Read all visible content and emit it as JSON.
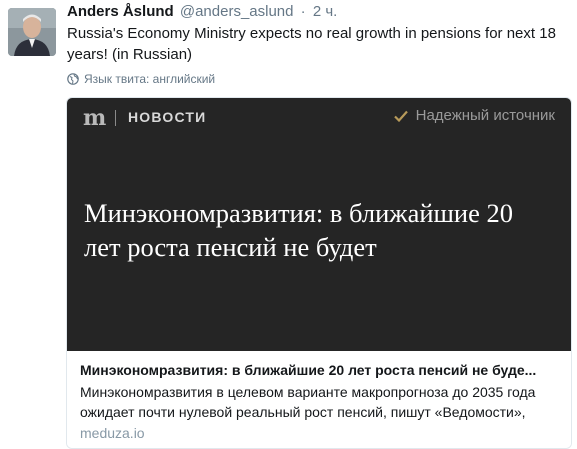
{
  "tweet": {
    "author_name": "Anders Åslund",
    "handle": "@anders_aslund",
    "separator": "·",
    "timestamp": "2 ч.",
    "text": "Russia's Economy Ministry expects no real growth in pensions for next 18 years! (in Russian)",
    "language_note": "Язык твита: английский"
  },
  "card": {
    "site_logo": "m",
    "section_label": "НОВОСТИ",
    "trusted_label": "Надежный источник",
    "headline": "Минэкономразвития: в ближайшие 20 лет роста пенсий не будет",
    "title": "Минэкономразвития: в ближайшие 20 лет роста пенсий не буде...",
    "description": "Минэкономразвития в целевом варианте макропрогноза до 2035 года ожидает почти нулевой реальный рост пенсий, пишут «Ведомости»,",
    "domain": "meduza.io"
  },
  "colors": {
    "card_image_bg": "#252525",
    "secondary_text": "#657786",
    "card_border": "#e1e8ed"
  },
  "icons": {
    "language": "globe-icon",
    "trusted": "checkmark-icon"
  }
}
